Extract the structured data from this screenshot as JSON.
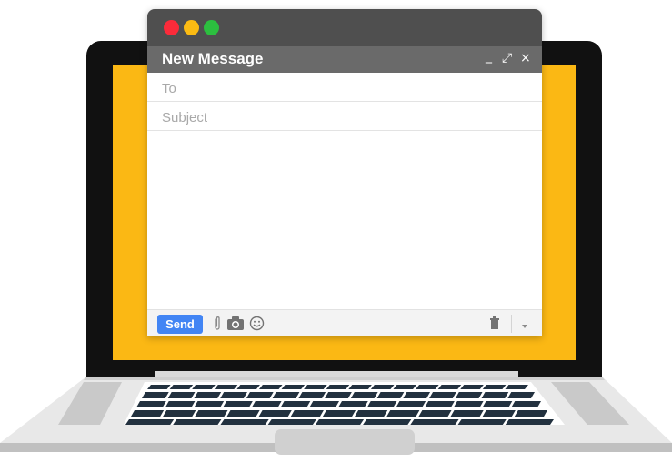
{
  "window": {
    "traffic_lights": [
      {
        "name": "close",
        "color": "#fb2b3a"
      },
      {
        "name": "minimize",
        "color": "#fbbb13"
      },
      {
        "name": "zoom",
        "color": "#2cbf3f"
      }
    ]
  },
  "compose": {
    "title": "New Message",
    "minimize_glyph": "_",
    "expand_glyph": "⤢",
    "close_glyph": "×",
    "to_placeholder": "To",
    "subject_placeholder": "Subject",
    "to_value": "",
    "subject_value": "",
    "body_value": ""
  },
  "toolbar": {
    "send_label": "Send",
    "icons": [
      "paperclip-icon",
      "camera-icon",
      "emoji-icon",
      "trash-icon",
      "dropdown-arrow-icon"
    ]
  },
  "colors": {
    "screen": "#fbb814",
    "titlebar": "#4f4f4f",
    "header": "#6a6a6a",
    "send": "#4285f4",
    "laptop_bezel": "#111111"
  }
}
